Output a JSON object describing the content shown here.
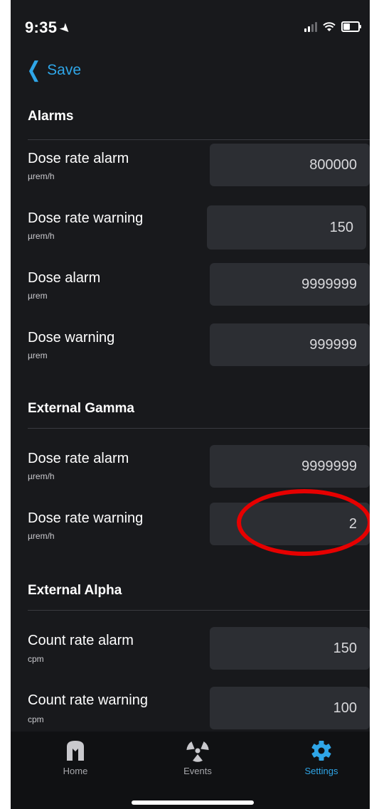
{
  "status": {
    "time": "9:35"
  },
  "nav": {
    "back_label": "Save"
  },
  "sections": [
    {
      "title": "Alarms",
      "rows": [
        {
          "label": "Dose rate alarm",
          "unit": "µrem/h",
          "value": "800000"
        },
        {
          "label": "Dose rate warning",
          "unit": "µrem/h",
          "value": "150"
        },
        {
          "label": "Dose alarm",
          "unit": "µrem",
          "value": "9999999"
        },
        {
          "label": "Dose warning",
          "unit": "µrem",
          "value": "999999"
        }
      ]
    },
    {
      "title": "External Gamma",
      "rows": [
        {
          "label": "Dose rate alarm",
          "unit": "µrem/h",
          "value": "9999999"
        },
        {
          "label": "Dose rate warning",
          "unit": "µrem/h",
          "value": "2"
        }
      ]
    },
    {
      "title": "External Alpha",
      "rows": [
        {
          "label": "Count rate alarm",
          "unit": "cpm",
          "value": "150"
        },
        {
          "label": "Count rate warning",
          "unit": "cpm",
          "value": "100"
        }
      ]
    }
  ],
  "tabs": [
    {
      "label": "Home",
      "icon": "home-logo-icon"
    },
    {
      "label": "Events",
      "icon": "radiation-icon"
    },
    {
      "label": "Settings",
      "icon": "gear-icon",
      "active": true
    }
  ],
  "colors": {
    "accent": "#2fa6e8",
    "background": "#18191c",
    "field": "#2c2e33",
    "highlight": "#e60000"
  }
}
